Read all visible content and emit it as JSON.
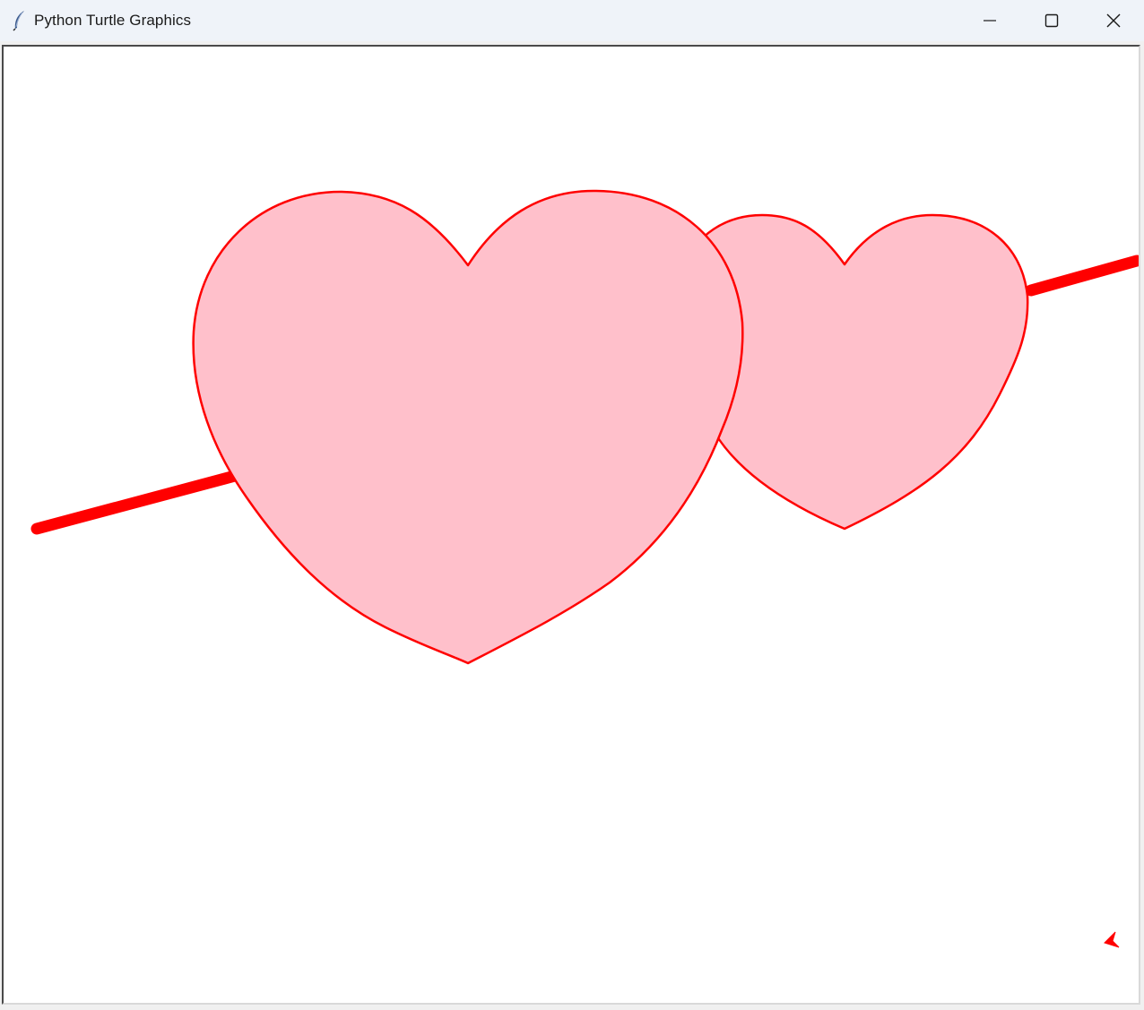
{
  "window": {
    "title": "Python Turtle Graphics",
    "app_icon": "feather-icon"
  },
  "controls": {
    "minimize_icon": "minimize-icon",
    "maximize_icon": "maximize-icon",
    "close_icon": "close-icon"
  },
  "canvas": {
    "background": "#ffffff",
    "stroke_color": "#ff0000",
    "fill_color": "#ffc0cb",
    "turtle_icon": "turtle-arrow-icon"
  }
}
